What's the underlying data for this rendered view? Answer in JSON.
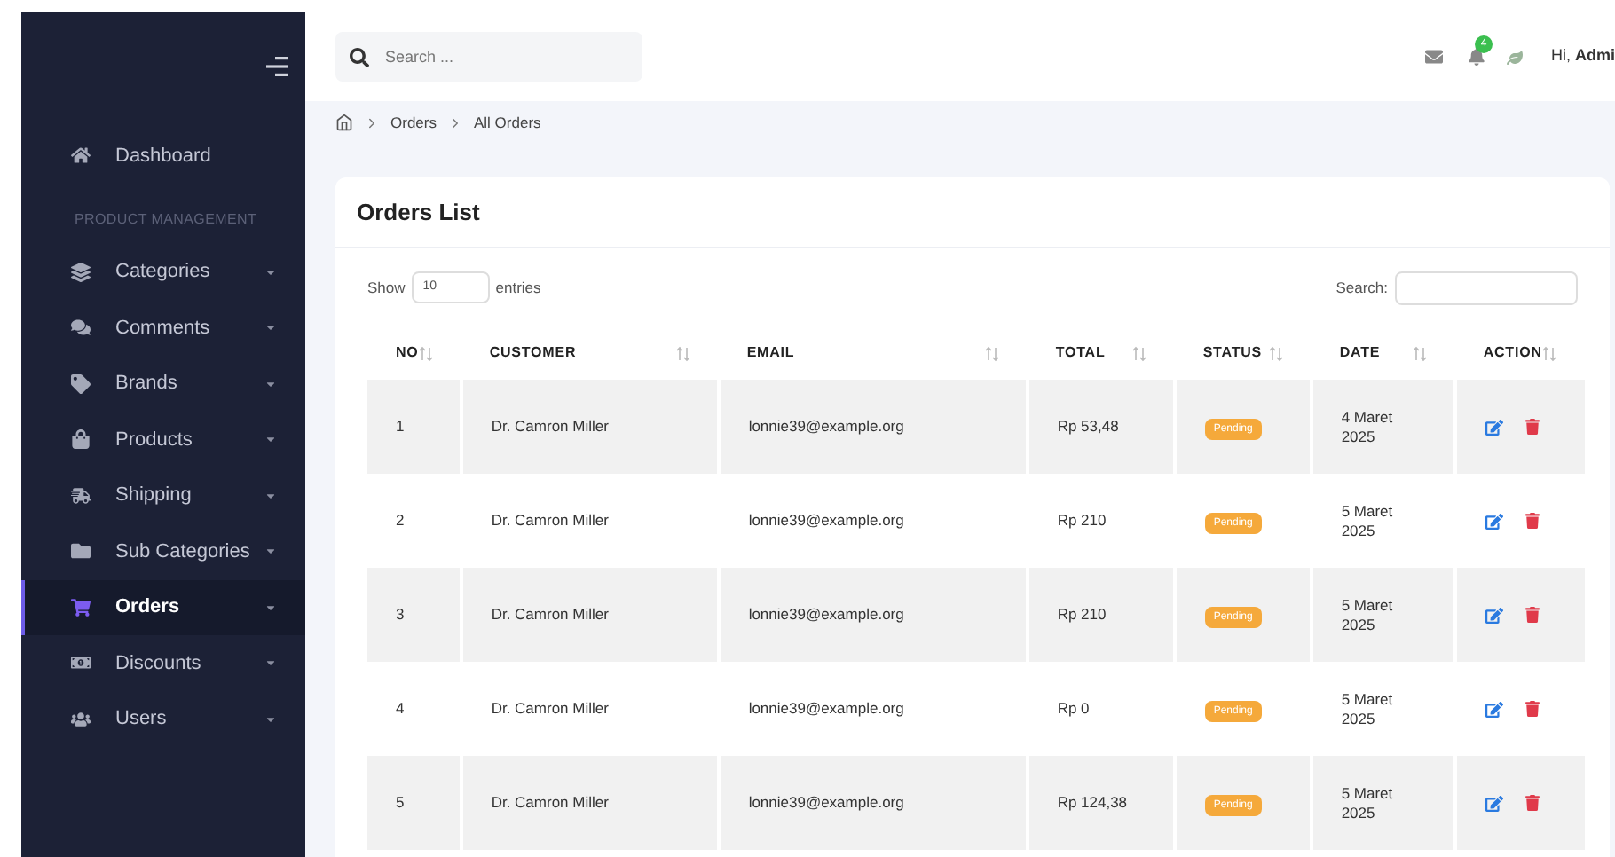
{
  "sidebar": {
    "section_label": "PRODUCT MANAGEMENT",
    "top_item": {
      "label": "Dashboard",
      "selected": false
    },
    "items": [
      {
        "label": "Categories",
        "selected": false
      },
      {
        "label": "Comments",
        "selected": false
      },
      {
        "label": "Brands",
        "selected": false
      },
      {
        "label": "Products",
        "selected": false
      },
      {
        "label": "Shipping",
        "selected": false
      },
      {
        "label": "Sub Categories",
        "selected": false
      },
      {
        "label": "Orders",
        "selected": true
      },
      {
        "label": "Discounts",
        "selected": false
      },
      {
        "label": "Users",
        "selected": false
      }
    ]
  },
  "header": {
    "search": {
      "placeholder": "Search ..."
    },
    "notification_count": "4",
    "greeting": "Hi, **Admi**"
  },
  "breadcrumb": [
    "Orders",
    "All Orders"
  ],
  "card": {
    "title": "Orders List",
    "show_label": "Show",
    "entries_value": "10",
    "entries_label": "entries",
    "search_label": "Search:"
  },
  "table": {
    "columns": [
      "NO",
      "CUSTOMER",
      "EMAIL",
      "TOTAL",
      "STATUS",
      "DATE",
      "ACTION"
    ],
    "rows": [
      {
        "no": "1",
        "customer": "Dr. Camron Miller",
        "email": "lonnie39@example.org",
        "total": "Rp 53,48",
        "status": "Pending",
        "date": "4 Maret 2025"
      },
      {
        "no": "2",
        "customer": "Dr. Camron Miller",
        "email": "lonnie39@example.org",
        "total": "Rp 210",
        "status": "Pending",
        "date": "5 Maret 2025"
      },
      {
        "no": "3",
        "customer": "Dr. Camron Miller",
        "email": "lonnie39@example.org",
        "total": "Rp 210",
        "status": "Pending",
        "date": "5 Maret 2025"
      },
      {
        "no": "4",
        "customer": "Dr. Camron Miller",
        "email": "lonnie39@example.org",
        "total": "Rp 0",
        "status": "Pending",
        "date": "5 Maret 2025"
      },
      {
        "no": "5",
        "customer": "Dr. Camron Miller",
        "email": "lonnie39@example.org",
        "total": "Rp 124,38",
        "status": "Pending",
        "date": "5 Maret 2025"
      }
    ]
  }
}
